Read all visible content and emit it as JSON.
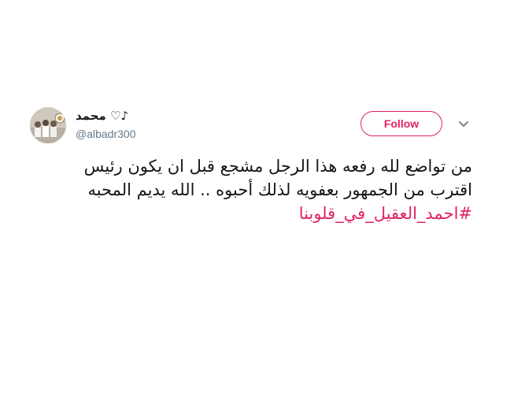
{
  "user": {
    "display_name": "محمد ♡♪",
    "username": "@albadr300",
    "avatar_icon": "profile-photo"
  },
  "actions": {
    "follow_label": "Follow",
    "more_icon": "chevron-down-icon",
    "accent_color": "#e0245e"
  },
  "tweet": {
    "line1": "من تواضع لله رفعه هذا الرجل مشجع قبل ان يكون رئيس",
    "line2": "اقترب من الجمهور بعفويه لذلك أحبوه .. الله يديم المحبه",
    "hashtag": "#احمد_العقيل_في_قلوبنا"
  }
}
